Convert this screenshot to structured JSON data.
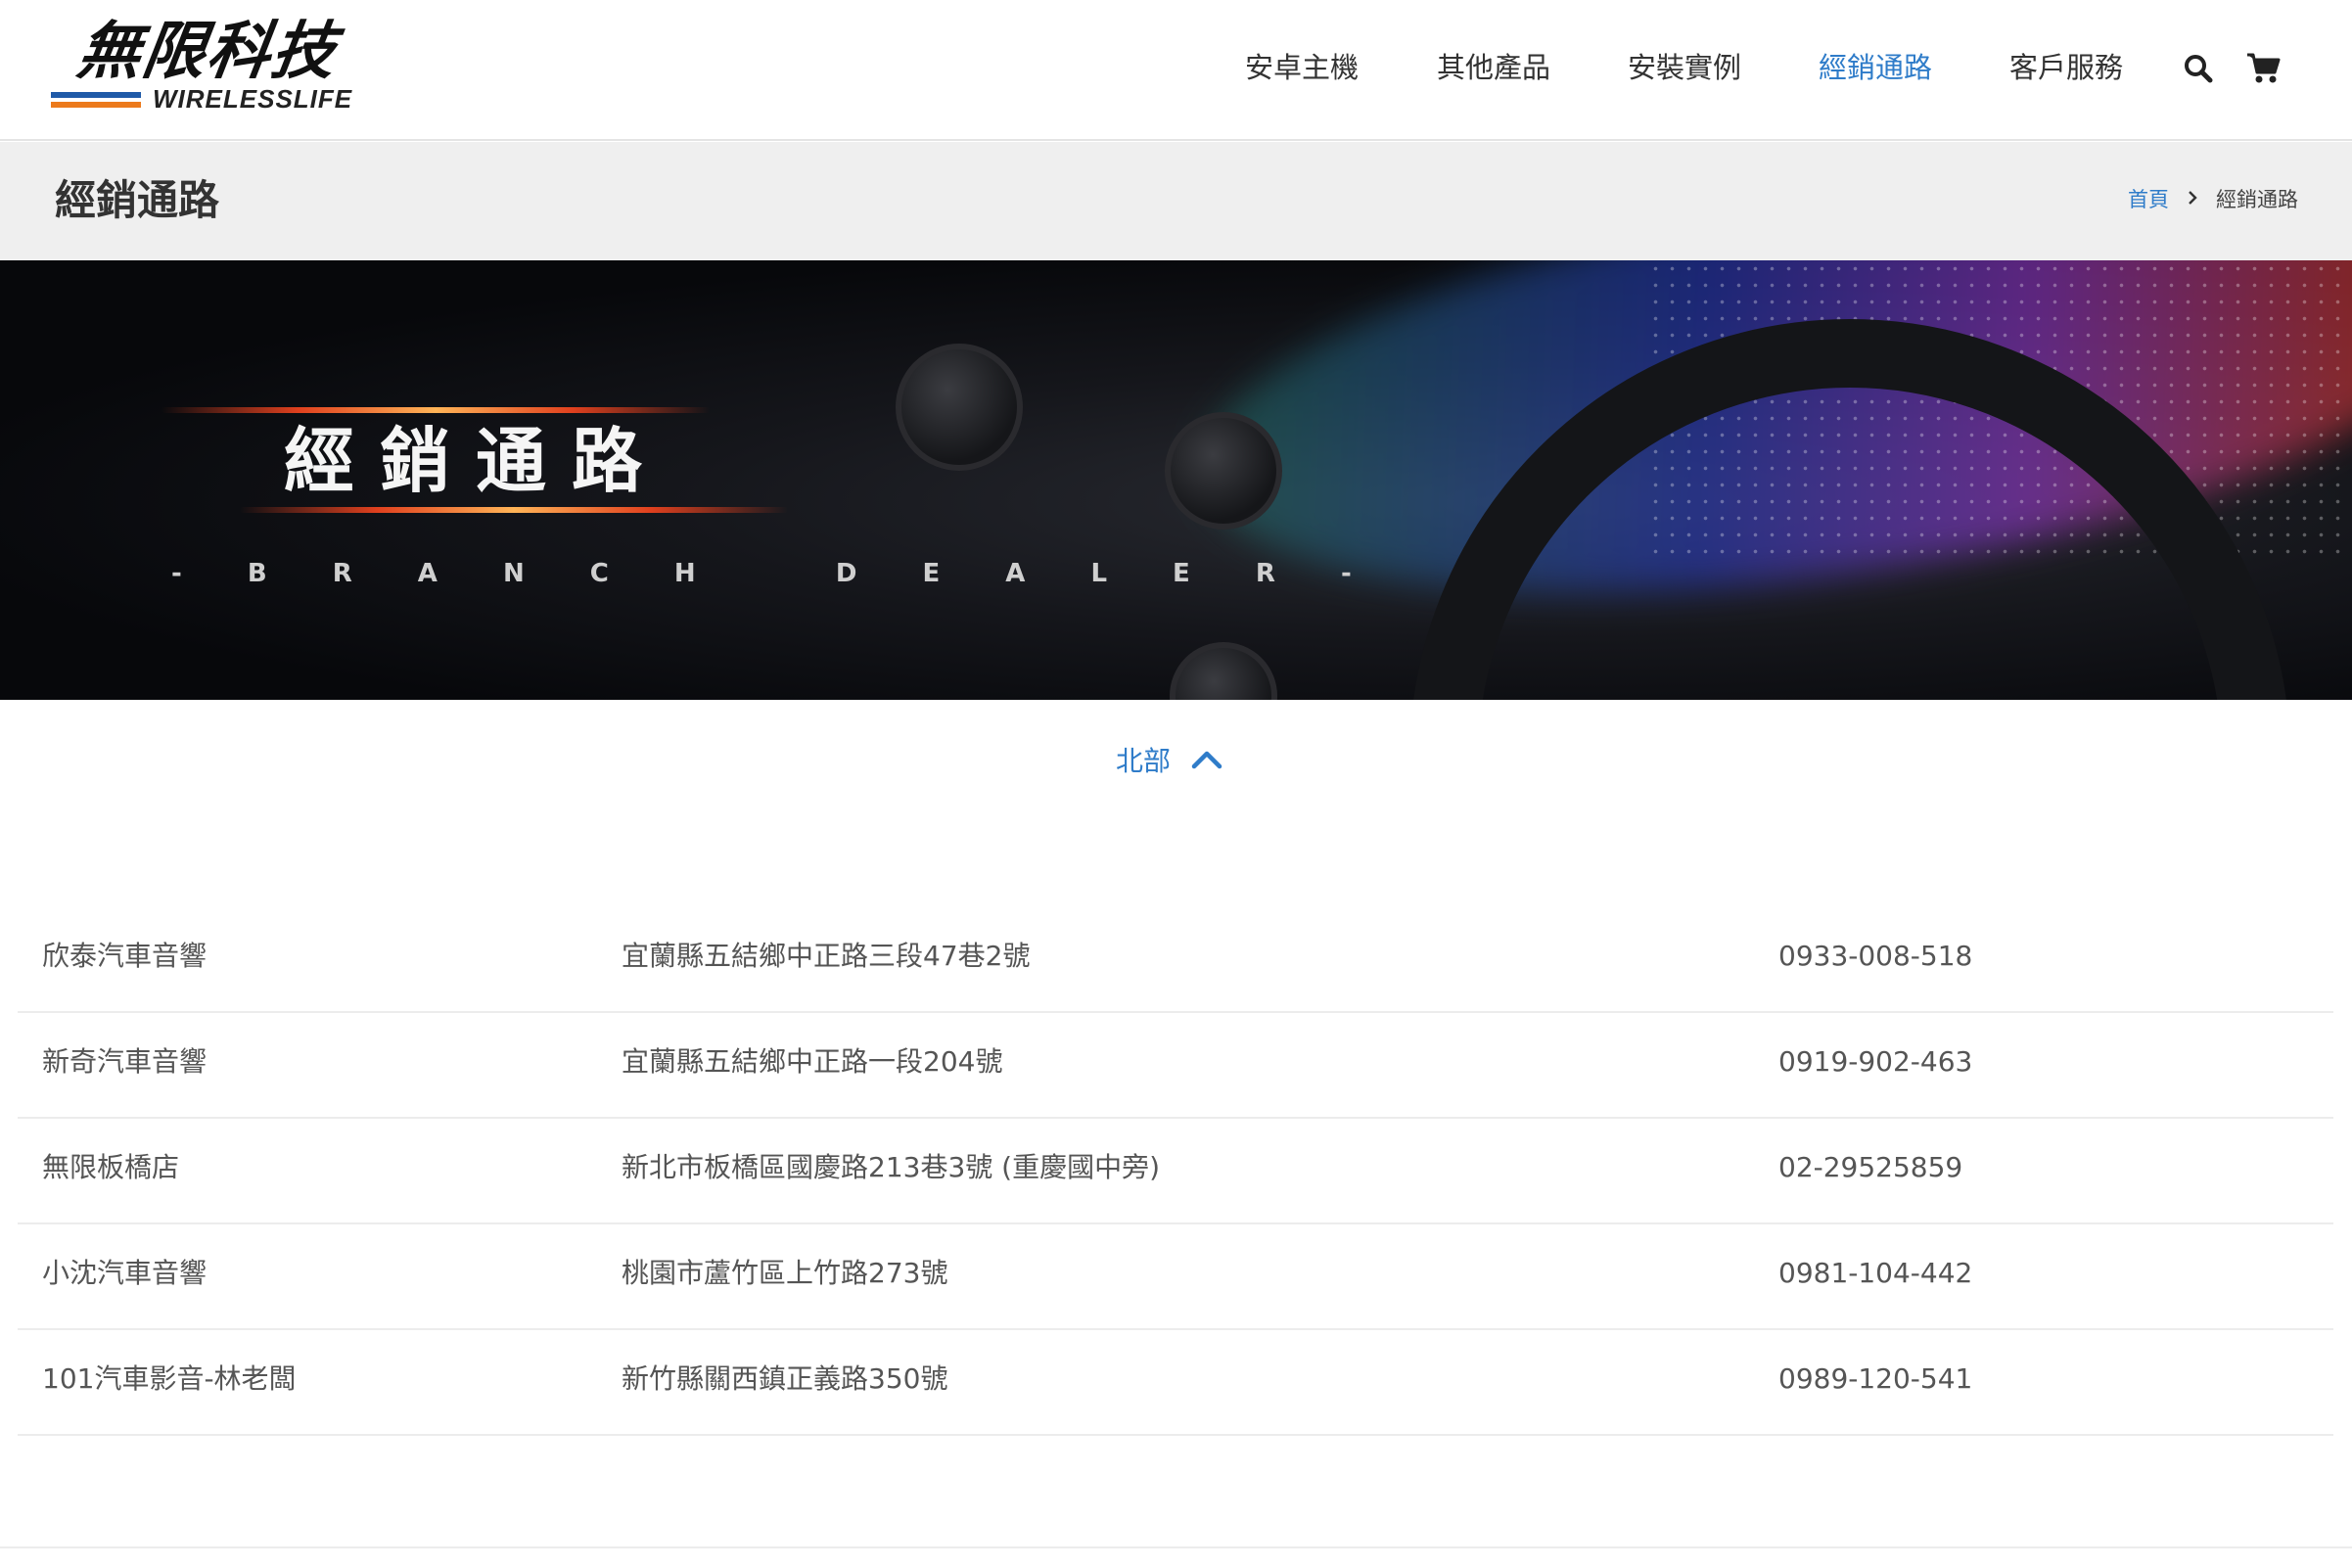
{
  "logo": {
    "cn": "無限科技",
    "en": "WIRELESSLIFE"
  },
  "nav": {
    "items": [
      {
        "label": "安卓主機"
      },
      {
        "label": "其他產品"
      },
      {
        "label": "安裝實例"
      },
      {
        "label": "經銷通路",
        "active": true
      },
      {
        "label": "客戶服務"
      }
    ],
    "search_icon": "search-icon",
    "cart_icon": "cart-icon"
  },
  "title_bar": {
    "title": "經銷通路",
    "breadcrumb": {
      "home": "首頁",
      "separator_icon": "chevron-right-icon",
      "current": "經銷通路"
    }
  },
  "banner": {
    "title": "經銷通路",
    "subtitle": "- B R A N C H   D E A L E R -"
  },
  "region": {
    "label": "北部",
    "toggle_icon": "chevron-up-icon",
    "expanded": true
  },
  "dealers": [
    {
      "name": "欣泰汽車音響",
      "address": "宜蘭縣五結鄉中正路三段47巷2號",
      "phone": "0933-008-518"
    },
    {
      "name": "新奇汽車音響",
      "address": "宜蘭縣五結鄉中正路一段204號",
      "phone": "0919-902-463"
    },
    {
      "name": "無限板橋店",
      "address": "新北市板橋區國慶路213巷3號  (重慶國中旁)",
      "phone": "02-29525859"
    },
    {
      "name": "小沈汽車音響",
      "address": "桃園市蘆竹區上竹路273號",
      "phone": "0981-104-442"
    },
    {
      "name": "101汽車影音-林老闆",
      "address": "新竹縣關西鎮正義路350號",
      "phone": "0989-120-541"
    }
  ],
  "colors": {
    "accent": "#2f7cc9",
    "nav_text": "#333333",
    "title_bar_bg": "#efefef",
    "logo_blue": "#1f5aa8",
    "logo_orange": "#ec7a1c"
  }
}
